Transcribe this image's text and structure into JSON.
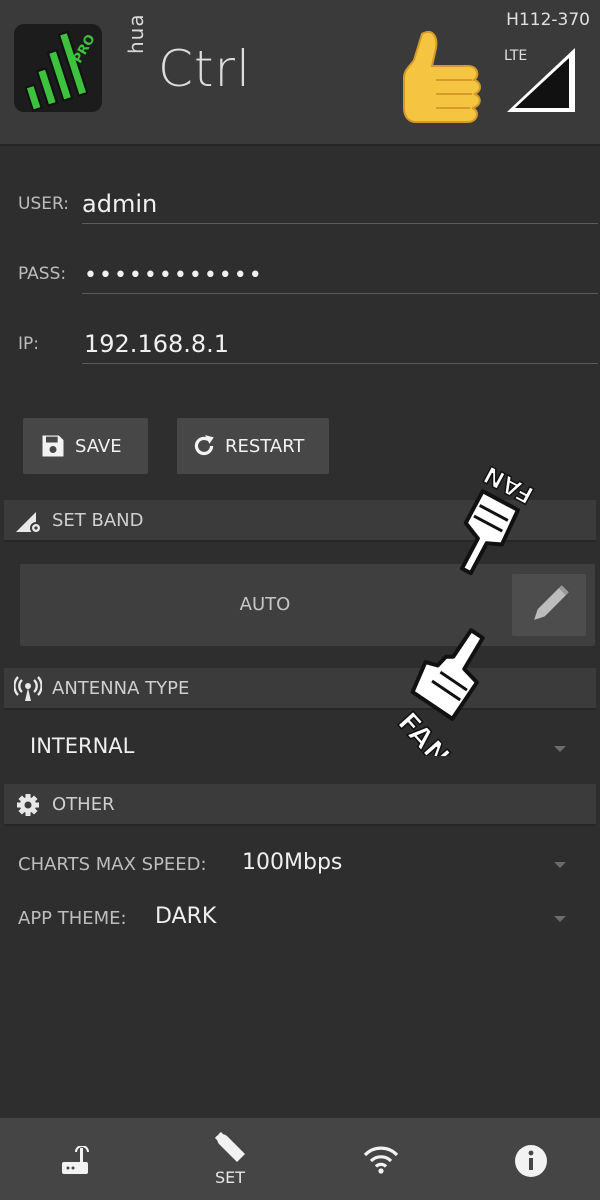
{
  "header": {
    "app_sub": "hua",
    "app_title": "Ctrl",
    "logo_badge": "PRO",
    "device_model": "H112-370",
    "network_type": "LTE"
  },
  "form": {
    "user_label": "USER:",
    "user_value": "admin",
    "pass_label": "PASS:",
    "pass_value": "••••••••••••",
    "ip_label": "IP:",
    "ip_value": "192.168.8.1"
  },
  "buttons": {
    "save_label": "SAVE",
    "restart_label": "RESTART"
  },
  "sections": {
    "set_band": "SET BAND",
    "antenna_type": "ANTENNA TYPE",
    "other": "OTHER"
  },
  "band": {
    "value": "AUTO"
  },
  "antenna": {
    "value": "INTERNAL"
  },
  "other": {
    "charts_label": "CHARTS MAX SPEED:",
    "charts_value": "100Mbps",
    "theme_label": "APP THEME:",
    "theme_value": "DARK"
  },
  "stickers": {
    "fan_top": "FAN",
    "fan_bottom": "FAN"
  },
  "nav": {
    "set_label": "SET"
  },
  "colors": {
    "background": "#2e2e2e",
    "header": "#3a3a3a",
    "section": "#3b3b3b",
    "logo_green": "#3cc23c"
  },
  "icons": [
    "logo-icon",
    "thumbs-up-icon",
    "signal-icon",
    "save-icon",
    "restart-icon",
    "band-settings-icon",
    "pencil-icon",
    "antenna-icon",
    "gear-icon",
    "router-icon",
    "wrench-icon",
    "wifi-icon",
    "info-icon"
  ]
}
